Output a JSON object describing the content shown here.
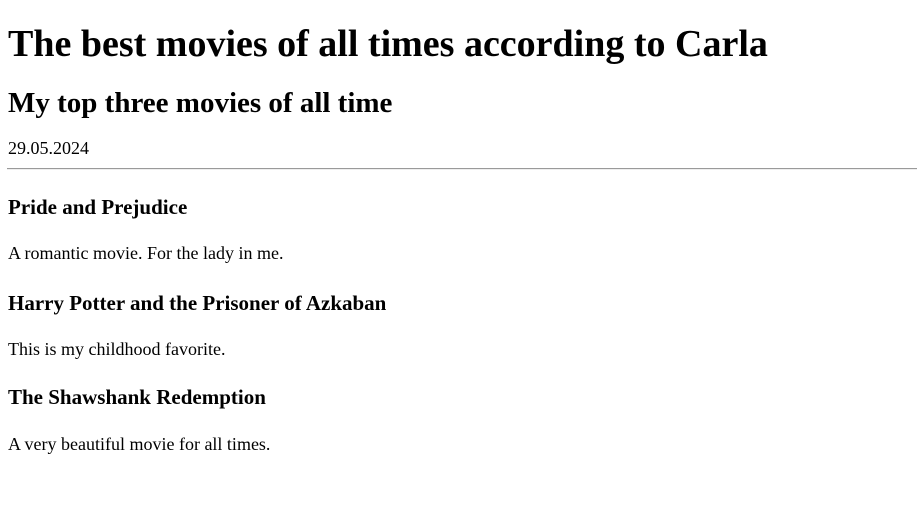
{
  "page": {
    "title": "The best movies of all times according to Carla",
    "subtitle": "My top three movies of all time",
    "date": "29.05.2024"
  },
  "movies": [
    {
      "title": "Pride and Prejudice",
      "description": "A romantic movie. For the lady in me."
    },
    {
      "title": "Harry Potter and the Prisoner of Azkaban",
      "description": "This is my childhood favorite."
    },
    {
      "title": "The Shawshank Redemption",
      "description": "A very beautiful movie for all times."
    }
  ]
}
